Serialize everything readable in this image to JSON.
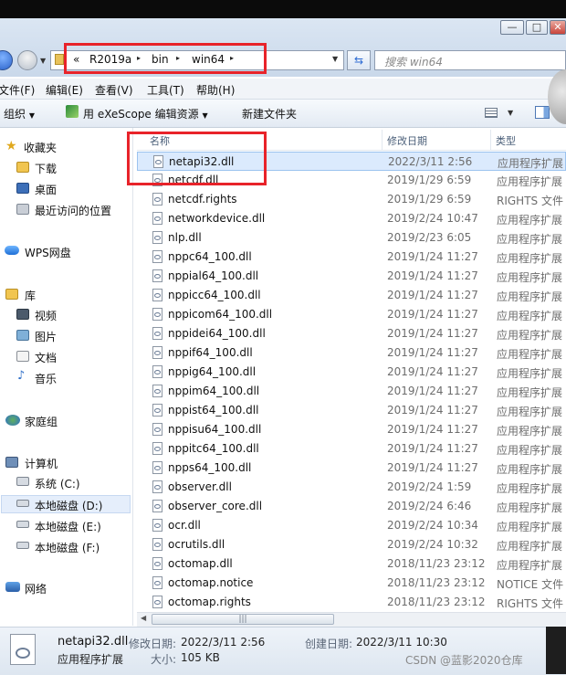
{
  "window": {
    "controls": {
      "minimize": "—",
      "maximize": "□",
      "close": "✕"
    }
  },
  "address": {
    "chevron": "«",
    "crumbs": [
      "R2019a",
      "bin",
      "win64"
    ],
    "arrow": "▸",
    "dropdown": "▼",
    "search_placeholder": "搜索 win64"
  },
  "menu": [
    "文件(F)",
    "编辑(E)",
    "查看(V)",
    "工具(T)",
    "帮助(H)"
  ],
  "toolbar": {
    "organize": "组织",
    "exescope": "用 eXeScope 编辑资源",
    "new_folder": "新建文件夹",
    "dropdown": "▼"
  },
  "nav": {
    "favorites": {
      "header": "收藏夹",
      "items": [
        "下载",
        "桌面",
        "最近访问的位置"
      ]
    },
    "wps": "WPS网盘",
    "libraries": {
      "header": "库",
      "items": [
        "视频",
        "图片",
        "文档",
        "音乐"
      ]
    },
    "homegroup": "家庭组",
    "computer": {
      "header": "计算机",
      "drives": [
        "系统 (C:)",
        "本地磁盘 (D:)",
        "本地磁盘 (E:)",
        "本地磁盘 (F:)"
      ]
    },
    "network": "网络"
  },
  "columns": {
    "name": "名称",
    "date": "修改日期",
    "type": "类型"
  },
  "files": [
    {
      "name": "netapi32.dll",
      "date": "2022/3/11 2:56",
      "type": "应用程序扩展"
    },
    {
      "name": "netcdf.dll",
      "date": "2019/1/29 6:59",
      "type": "应用程序扩展"
    },
    {
      "name": "netcdf.rights",
      "date": "2019/1/29 6:59",
      "type": "RIGHTS 文件"
    },
    {
      "name": "networkdevice.dll",
      "date": "2019/2/24 10:47",
      "type": "应用程序扩展"
    },
    {
      "name": "nlp.dll",
      "date": "2019/2/23 6:05",
      "type": "应用程序扩展"
    },
    {
      "name": "nppc64_100.dll",
      "date": "2019/1/24 11:27",
      "type": "应用程序扩展"
    },
    {
      "name": "nppial64_100.dll",
      "date": "2019/1/24 11:27",
      "type": "应用程序扩展"
    },
    {
      "name": "nppicc64_100.dll",
      "date": "2019/1/24 11:27",
      "type": "应用程序扩展"
    },
    {
      "name": "nppicom64_100.dll",
      "date": "2019/1/24 11:27",
      "type": "应用程序扩展"
    },
    {
      "name": "nppidei64_100.dll",
      "date": "2019/1/24 11:27",
      "type": "应用程序扩展"
    },
    {
      "name": "nppif64_100.dll",
      "date": "2019/1/24 11:27",
      "type": "应用程序扩展"
    },
    {
      "name": "nppig64_100.dll",
      "date": "2019/1/24 11:27",
      "type": "应用程序扩展"
    },
    {
      "name": "nppim64_100.dll",
      "date": "2019/1/24 11:27",
      "type": "应用程序扩展"
    },
    {
      "name": "nppist64_100.dll",
      "date": "2019/1/24 11:27",
      "type": "应用程序扩展"
    },
    {
      "name": "nppisu64_100.dll",
      "date": "2019/1/24 11:27",
      "type": "应用程序扩展"
    },
    {
      "name": "nppitc64_100.dll",
      "date": "2019/1/24 11:27",
      "type": "应用程序扩展"
    },
    {
      "name": "npps64_100.dll",
      "date": "2019/1/24 11:27",
      "type": "应用程序扩展"
    },
    {
      "name": "observer.dll",
      "date": "2019/2/24 1:59",
      "type": "应用程序扩展"
    },
    {
      "name": "observer_core.dll",
      "date": "2019/2/24 6:46",
      "type": "应用程序扩展"
    },
    {
      "name": "ocr.dll",
      "date": "2019/2/24 10:34",
      "type": "应用程序扩展"
    },
    {
      "name": "ocrutils.dll",
      "date": "2019/2/24 10:32",
      "type": "应用程序扩展"
    },
    {
      "name": "octomap.dll",
      "date": "2018/11/23 23:12",
      "type": "应用程序扩展"
    },
    {
      "name": "octomap.notice",
      "date": "2018/11/23 23:12",
      "type": "NOTICE 文件"
    },
    {
      "name": "octomap.rights",
      "date": "2018/11/23 23:12",
      "type": "RIGHTS 文件"
    }
  ],
  "selected_index": 0,
  "scroll": {
    "thumb_grip": "|||"
  },
  "details": {
    "filename": "netapi32.dll",
    "filetype": "应用程序扩展",
    "modified_label": "修改日期:",
    "modified": "2022/3/11 2:56",
    "created_label": "创建日期:",
    "created": "2022/3/11 10:30",
    "size_label": "大小:",
    "size": "105 KB"
  },
  "watermark": "CSDN @蓝影2020仓库",
  "colors": {
    "highlight": "#e8232a",
    "selection": "#dbeafd"
  }
}
